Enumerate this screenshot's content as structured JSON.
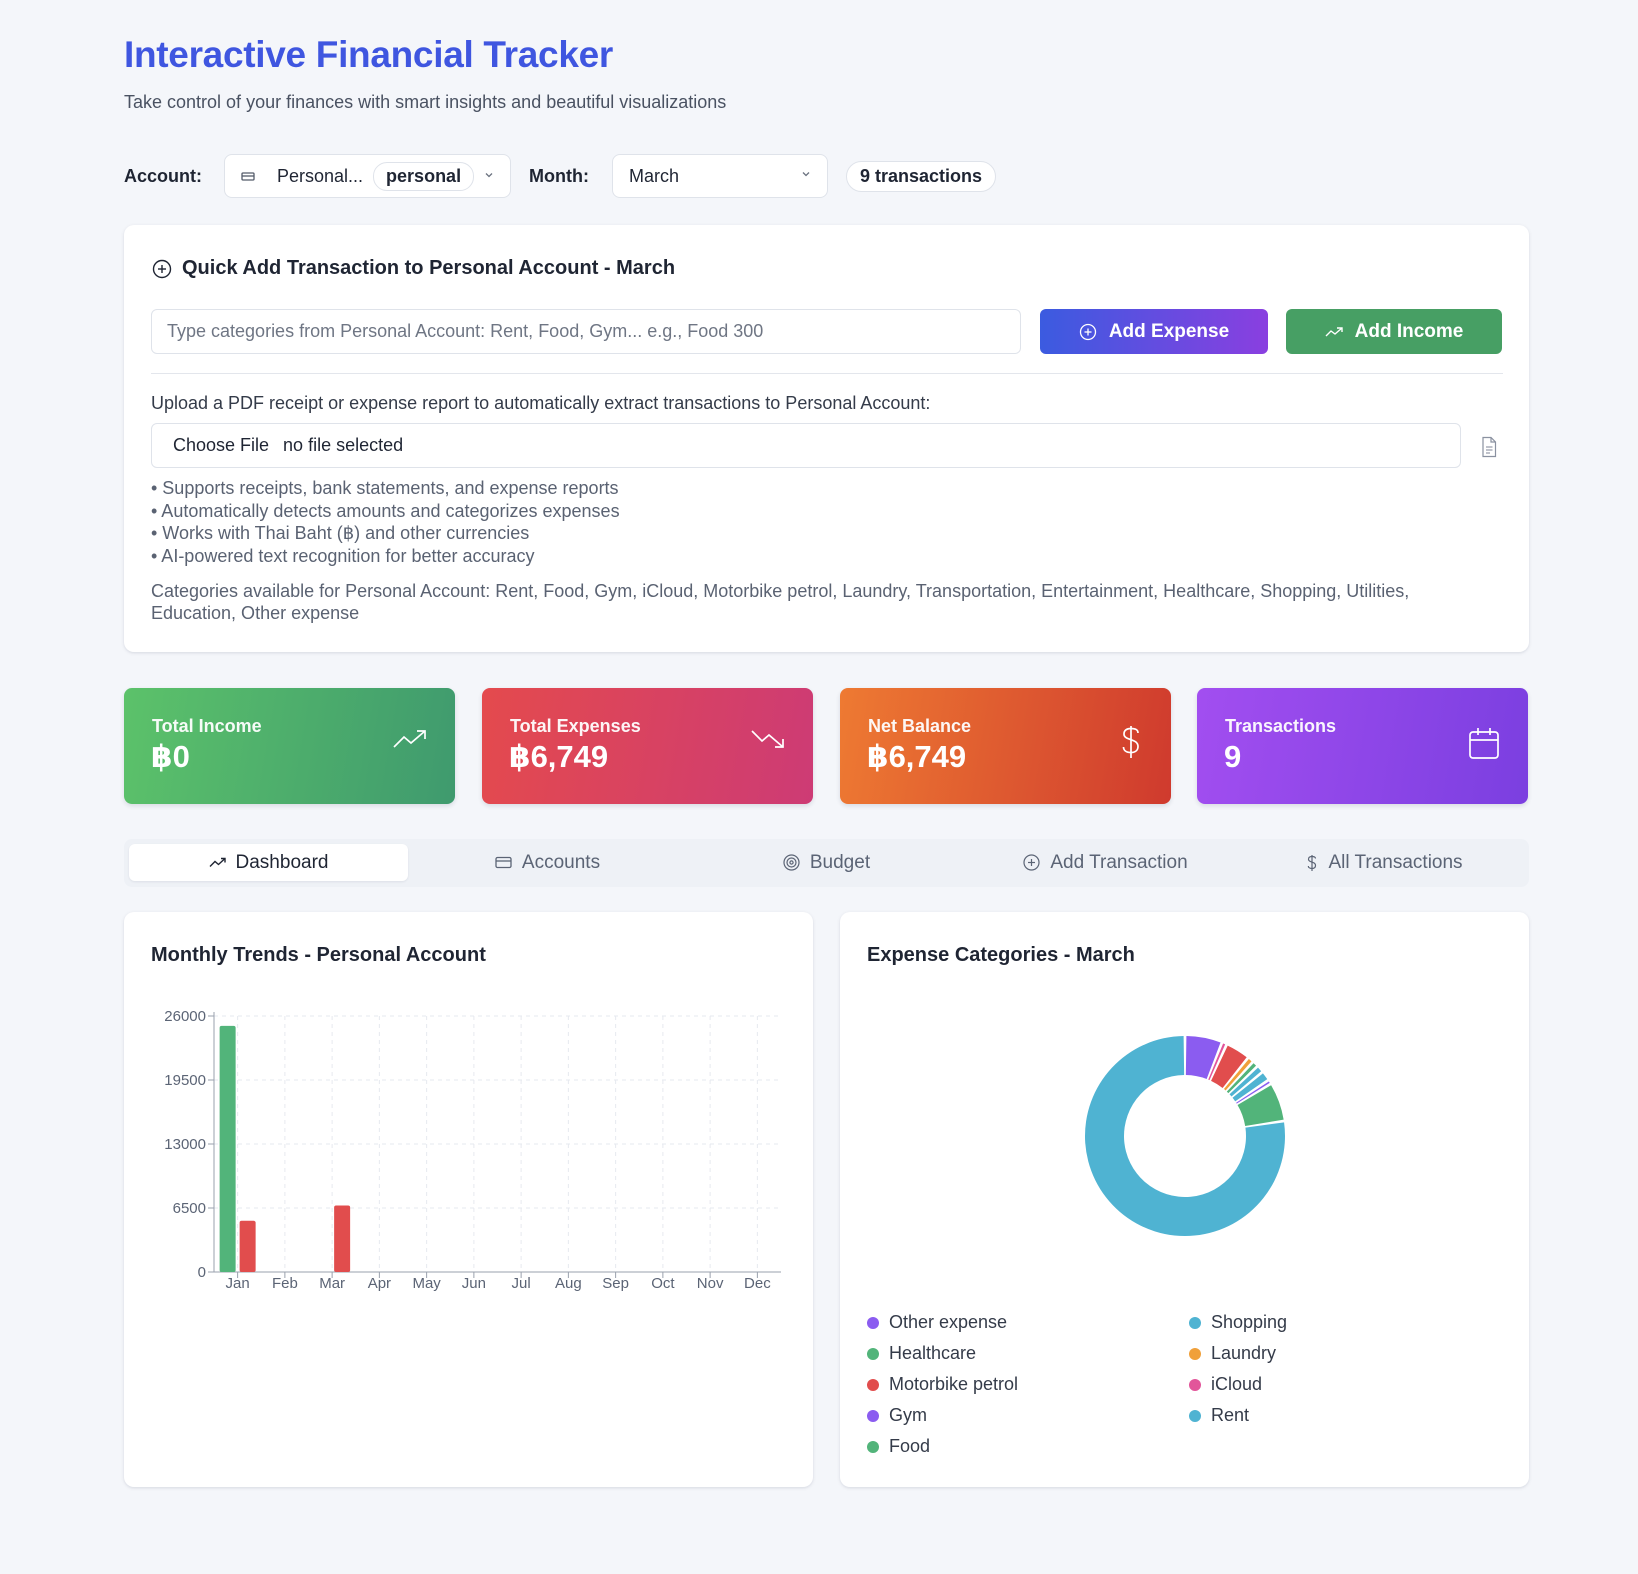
{
  "header": {
    "title": "Interactive Financial Tracker",
    "subtitle": "Take control of your finances with smart insights and beautiful visualizations"
  },
  "toolbar": {
    "account_label": "Account:",
    "account_value": "Personal...",
    "account_type": "personal",
    "month_label": "Month:",
    "month_value": "March",
    "transactions_badge": "9 transactions"
  },
  "quick_add": {
    "title": "Quick Add Transaction to Personal Account - March",
    "input_placeholder": "Type categories from Personal Account: Rent, Food, Gym... e.g., Food 300",
    "add_expense_label": "Add Expense",
    "add_income_label": "Add Income",
    "upload_label": "Upload a PDF receipt or expense report to automatically extract transactions to Personal Account:",
    "choose_file_label": "Choose File",
    "no_file_label": "no file selected",
    "bullets": [
      "• Supports receipts, bank statements, and expense reports",
      "• Automatically detects amounts and categorizes expenses",
      "• Works with Thai Baht (฿) and other currencies",
      "• AI-powered text recognition for better accuracy"
    ],
    "categories_text": "Categories available for Personal Account: Rent, Food, Gym, iCloud, Motorbike petrol, Laundry, Transportation, Entertainment, Healthcare, Shopping, Utilities, Education, Other expense"
  },
  "stats": [
    {
      "label": "Total Income",
      "value": "฿0",
      "icon": "trending-up-icon"
    },
    {
      "label": "Total Expenses",
      "value": "฿6,749",
      "icon": "trending-down-icon"
    },
    {
      "label": "Net Balance",
      "value": "฿6,749",
      "icon": "dollar-icon"
    },
    {
      "label": "Transactions",
      "value": "9",
      "icon": "calendar-icon"
    }
  ],
  "tabs": [
    {
      "label": "Dashboard",
      "icon": "trending-up-icon",
      "active": true
    },
    {
      "label": "Accounts",
      "icon": "card-icon",
      "active": false
    },
    {
      "label": "Budget",
      "icon": "target-icon",
      "active": false
    },
    {
      "label": "Add Transaction",
      "icon": "plus-circle-icon",
      "active": false
    },
    {
      "label": "All Transactions",
      "icon": "dollar-icon",
      "active": false
    }
  ],
  "trends_panel": {
    "title": "Monthly Trends - Personal Account"
  },
  "categories_panel": {
    "title": "Expense Categories - March"
  },
  "colors": {
    "income": "#52b47a",
    "expense": "#e14d4d",
    "title": "#3f56e0"
  },
  "chart_data": [
    {
      "type": "bar",
      "title": "Monthly Trends - Personal Account",
      "categories": [
        "Jan",
        "Feb",
        "Mar",
        "Apr",
        "May",
        "Jun",
        "Jul",
        "Aug",
        "Sep",
        "Oct",
        "Nov",
        "Dec"
      ],
      "series": [
        {
          "values": [
            25000,
            0,
            0,
            0,
            0,
            0,
            0,
            0,
            0,
            0,
            0,
            0
          ],
          "color": "#52b47a"
        },
        {
          "values": [
            5200,
            0,
            6749,
            0,
            0,
            0,
            0,
            0,
            0,
            0,
            0,
            0
          ],
          "color": "#e14d4d"
        }
      ],
      "yticks": [
        0,
        6500,
        13000,
        19500,
        26000
      ],
      "ylim": [
        0,
        26000
      ],
      "grid": true
    },
    {
      "type": "pie",
      "title": "Expense Categories - March",
      "donut": true,
      "slices": [
        {
          "name": "Other expense",
          "value": 6.0,
          "color": "#8b5cf0"
        },
        {
          "name": "iCloud",
          "value": 0.8,
          "color": "#e2559a"
        },
        {
          "name": "Motorbike petrol",
          "value": 4.0,
          "color": "#e14d4d"
        },
        {
          "name": "Laundry",
          "value": 1.0,
          "color": "#f0a03a"
        },
        {
          "name": "Food",
          "value": 1.0,
          "color": "#52b47a"
        },
        {
          "name": "Shopping",
          "value": 1.2,
          "color": "#4fb3d2"
        },
        {
          "name": "Rent",
          "value": 1.6,
          "color": "#4fb3d2"
        },
        {
          "name": "Gym",
          "value": 0.7,
          "color": "#8b5cf0"
        },
        {
          "name": "Healthcare",
          "value": 6.3,
          "color": "#52b47a"
        },
        {
          "name": "Rent",
          "value": 77.4,
          "color": "#4fb3d2"
        }
      ],
      "legend": [
        {
          "name": "Other expense",
          "color": "#8b5cf0"
        },
        {
          "name": "Shopping",
          "color": "#4fb3d2"
        },
        {
          "name": "Healthcare",
          "color": "#52b47a"
        },
        {
          "name": "Laundry",
          "color": "#f0a03a"
        },
        {
          "name": "Motorbike petrol",
          "color": "#e14d4d"
        },
        {
          "name": "iCloud",
          "color": "#e2559a"
        },
        {
          "name": "Gym",
          "color": "#8b5cf0"
        },
        {
          "name": "Rent",
          "color": "#4fb3d2"
        },
        {
          "name": "Food",
          "color": "#52b47a"
        }
      ],
      "legend_position": "bottom"
    }
  ]
}
